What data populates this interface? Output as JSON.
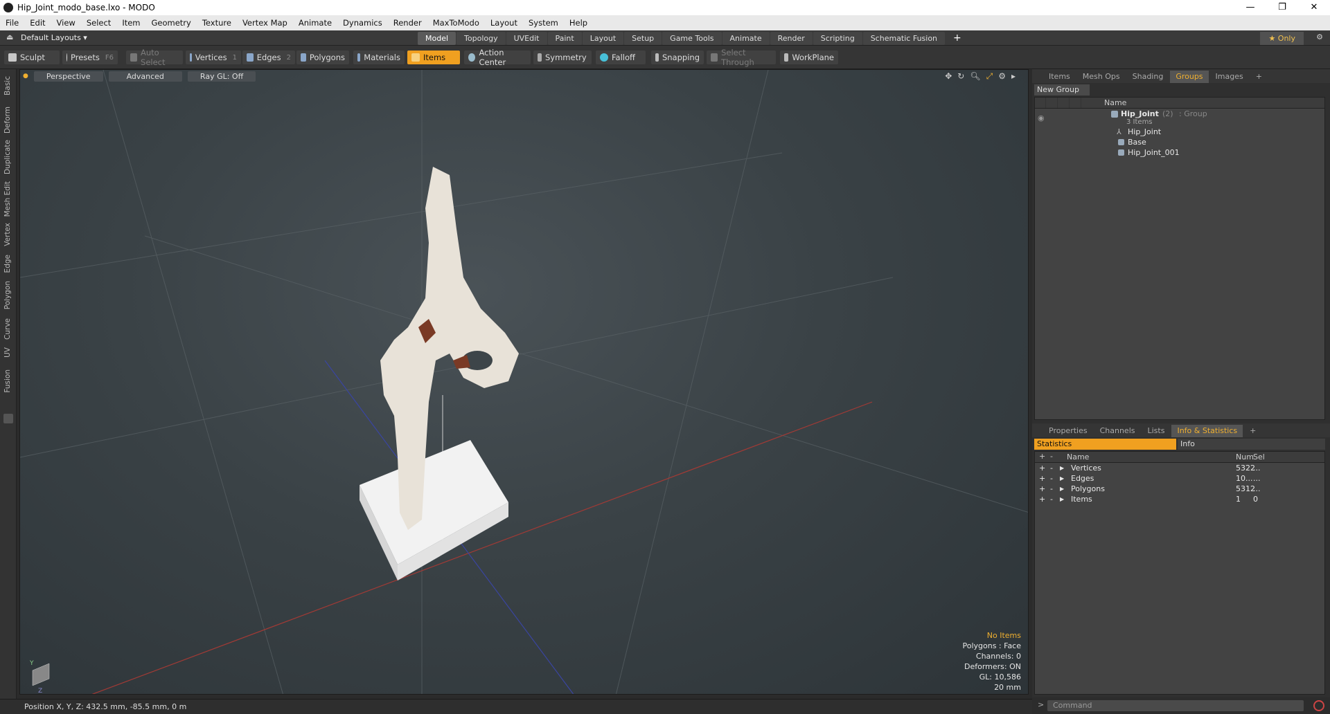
{
  "window": {
    "title": "Hip_Joint_modo_base.lxo - MODO",
    "minimize": "—",
    "maximize": "❐",
    "close": "✕"
  },
  "menu": [
    "File",
    "Edit",
    "View",
    "Select",
    "Item",
    "Geometry",
    "Texture",
    "Vertex Map",
    "Animate",
    "Dynamics",
    "Render",
    "MaxToModo",
    "Layout",
    "System",
    "Help"
  ],
  "layoutbar": {
    "layouts": "Default Layouts ▾",
    "tabs": [
      "Model",
      "Topology",
      "UVEdit",
      "Paint",
      "Layout",
      "Setup",
      "Game Tools",
      "Animate",
      "Render",
      "Scripting",
      "Schematic Fusion"
    ],
    "active_tab": "Model",
    "add": "+",
    "only": "★  Only",
    "gear": "⚙"
  },
  "toolbar": {
    "sculpt": "Sculpt",
    "presets": "Presets",
    "presets_key": "F6",
    "auto_select": "Auto Select",
    "vertices": "Vertices",
    "vertices_key": "1",
    "edges": "Edges",
    "edges_key": "2",
    "polygons": "Polygons",
    "materials": "Materials",
    "items": "Items",
    "action_center": "Action Center",
    "symmetry": "Symmetry",
    "falloff": "Falloff",
    "snapping": "Snapping",
    "select_through": "Select Through",
    "workplane": "WorkPlane"
  },
  "left_tabs": [
    "Basic",
    "Deform",
    "Duplicate",
    "Mesh Edit",
    "Vertex",
    "Edge",
    "Polygon",
    "Curve",
    "UV",
    "Fusion"
  ],
  "viewport": {
    "view": "Perspective",
    "shading": "Advanced",
    "raygl": "Ray GL: Off",
    "info": {
      "selection": "No Items",
      "polygons": "Polygons : Face",
      "channels": "Channels: 0",
      "deformers": "Deformers: ON",
      "gl": "GL: 10,586",
      "scale": "20 mm"
    }
  },
  "status": {
    "position": "Position X, Y, Z:   432.5 mm, -85.5 mm, 0 m"
  },
  "groups_panel": {
    "tabs": [
      "Items",
      "Mesh Ops",
      "Shading",
      "Groups",
      "Images",
      "+"
    ],
    "active_tab": "Groups",
    "new_group": "New Group",
    "name_header": "Name",
    "group": {
      "name": "Hip_Joint",
      "count": "(2)",
      "type": ": Group",
      "items_count": "3 Items"
    },
    "children": [
      "Hip_Joint",
      "Base",
      "Hip_Joint_001"
    ]
  },
  "stats_panel": {
    "tabs": [
      "Properties",
      "Channels",
      "Lists",
      "Info & Statistics",
      "+"
    ],
    "active_tab": "Info & Statistics",
    "sub_tabs": [
      "Statistics",
      "Info"
    ],
    "headers": {
      "name": "Name",
      "num": "Num",
      "sel": "Sel"
    },
    "rows": [
      {
        "name": "Vertices",
        "num": "5322",
        "sel": "..."
      },
      {
        "name": "Edges",
        "num": "10...",
        "sel": "..."
      },
      {
        "name": "Polygons",
        "num": "5312",
        "sel": "..."
      },
      {
        "name": "Items",
        "num": "1",
        "sel": "0"
      }
    ]
  },
  "command": {
    "placeholder": "Command"
  }
}
